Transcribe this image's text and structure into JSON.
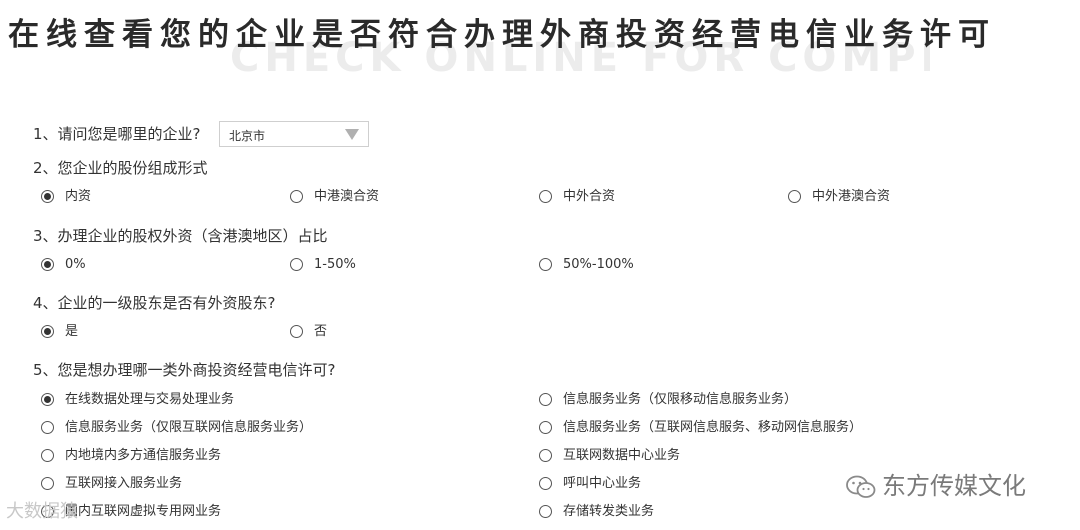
{
  "page": {
    "title": "在线查看您的企业是否符合办理外商投资经营电信业务许可",
    "title_bg": "CHECK ONLINE FOR COMPLIANCE"
  },
  "q1": {
    "label": "1、请问您是哪里的企业?",
    "selected": "北京市"
  },
  "q2": {
    "label": "2、您企业的股份组成形式",
    "options": [
      "内资",
      "中港澳合资",
      "中外合资",
      "中外港澳合资"
    ],
    "selected_index": 0
  },
  "q3": {
    "label": "3、办理企业的股权外资（含港澳地区）占比",
    "options": [
      "0%",
      "1-50%",
      "50%-100%"
    ],
    "selected_index": 0
  },
  "q4": {
    "label": "4、企业的一级股东是否有外资股东?",
    "options": [
      "是",
      "否"
    ],
    "selected_index": 0
  },
  "q5": {
    "label": "5、您是想办理哪一类外商投资经营电信许可?",
    "options": [
      "在线数据处理与交易处理业务",
      "信息服务业务（仅限移动信息服务业务）",
      "信息服务业务（仅限互联网信息服务业务）",
      "信息服务业务（互联网信息服务、移动网信息服务）",
      "内地境内多方通信服务业务",
      "互联网数据中心业务",
      "互联网接入服务业务",
      "呼叫中心业务",
      "国内互联网虚拟专用网业务",
      "存储转发类业务"
    ],
    "selected_index": 0
  },
  "watermarks": {
    "right": "东方传媒文化",
    "left": "大数据猿"
  }
}
